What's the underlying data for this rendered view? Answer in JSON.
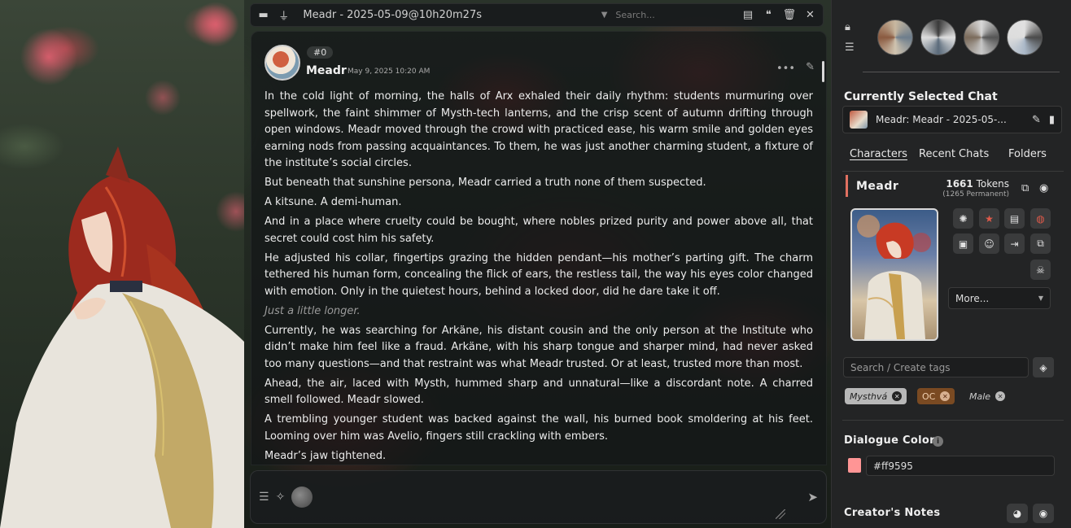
{
  "topbar": {
    "chat_title": "Meadr - 2025-05-09@10h20m27s",
    "search_placeholder": "Search..."
  },
  "message": {
    "id": "#0",
    "name": "Meadr",
    "date": "May 9, 2025 10:20 AM",
    "paragraphs": [
      "In the cold light of morning, the halls of Arx exhaled their daily rhythm: students murmuring over spellwork, the faint shimmer of Mysth-tech lanterns, and the crisp scent of autumn drifting through open windows. Meadr moved through the crowd with practiced ease, his warm smile and golden eyes earning nods from passing acquaintances. To them, he was just another charming student, a fixture of the institute’s social circles.",
      "But beneath that sunshine persona, Meadr carried a truth none of them suspected.",
      "A kitsune. A demi-human.",
      "And in a place where cruelty could be bought, where nobles prized purity and power above all, that secret could cost him his safety.",
      "He adjusted his collar, fingertips grazing the hidden pendant—his mother’s parting gift. The charm tethered his human form, concealing the flick of ears, the restless tail, the way his eyes color changed with emotion. Only in the quietest hours, behind a locked door, did he dare take it off.",
      "Just a little longer.",
      "Currently, he was searching for Arkäne, his distant cousin and the only person at the Institute who didn’t make him feel like a fraud. Arkäne, with his sharp tongue and sharper mind, had never asked too many questions—and that restraint was what Meadr trusted. Or at least, trusted more than most.",
      "Ahead, the air, laced with Mysth, hummed sharp and unnatural—like a discordant note. A charred smell followed. Meadr slowed.",
      "A trembling younger student was backed against the wall, his burned book smoldering at his feet. Looming over him was Avelio, fingers still crackling with embers.",
      "Meadr’s jaw tightened."
    ]
  },
  "panel": {
    "selected_title": "Currently Selected Chat",
    "selected_chat": "Meadr: Meadr - 2025-05-...",
    "tabs": [
      "Characters",
      "Recent Chats",
      "Folders"
    ],
    "char_name": "Meadr",
    "tokens_count": "1661",
    "tokens_label": "Tokens",
    "tokens_permanent": "(1265 Permanent)",
    "more_label": "More...",
    "tag_placeholder": "Search / Create tags",
    "tags": [
      "Mysthvá",
      "OC",
      "Male"
    ],
    "dialogue_label": "Dialogue Color",
    "dialogue_color": "#ff9595",
    "notes_label": "Creator's Notes"
  },
  "colors": {
    "accent_bar": "#e07060",
    "tag_oc_bg": "#7a4a22"
  },
  "icons": {
    "topbar": [
      "archive-icon",
      "plug-icon",
      "chevron-down-icon",
      "book-icon",
      "comments-icon",
      "trash-icon",
      "close-icon"
    ],
    "actions": [
      "brain-icon",
      "star-icon",
      "book-icon",
      "globe-icon",
      "passport-icon",
      "smile-icon",
      "export-icon",
      "clone-icon",
      "skull-icon"
    ]
  }
}
